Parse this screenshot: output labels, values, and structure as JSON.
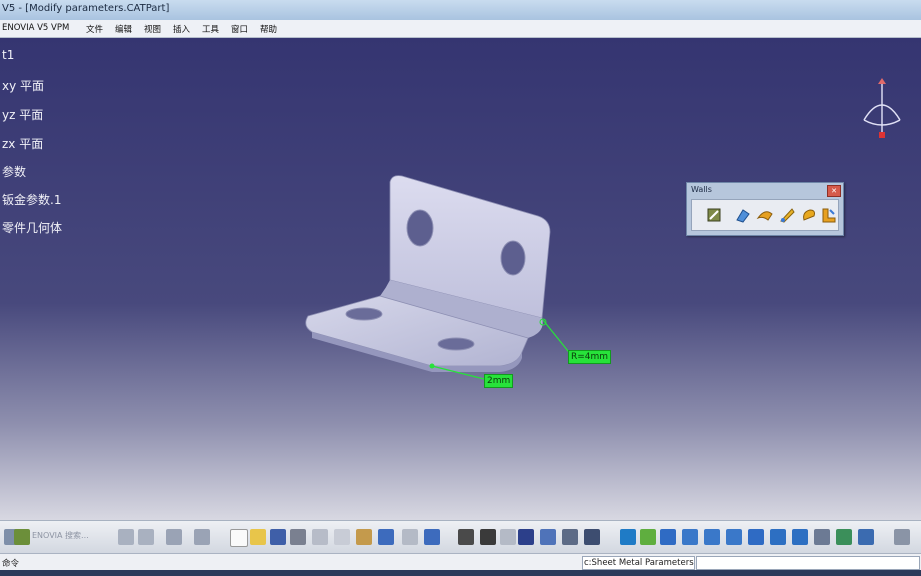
{
  "window": {
    "title": "V5 - [Modify parameters.CATPart]"
  },
  "menu": [
    {
      "id": "enovia",
      "label": "ENOVIA V5 VPM"
    },
    {
      "id": "file",
      "label": "文件"
    },
    {
      "id": "edit",
      "label": "编辑"
    },
    {
      "id": "view",
      "label": "视图"
    },
    {
      "id": "insert",
      "label": "插入"
    },
    {
      "id": "tools",
      "label": "工具"
    },
    {
      "id": "window",
      "label": "窗口"
    },
    {
      "id": "help",
      "label": "帮助"
    }
  ],
  "tree": [
    {
      "id": "root",
      "label": "t1"
    },
    {
      "id": "xy",
      "label": "xy 平面"
    },
    {
      "id": "yz",
      "label": "yz 平面"
    },
    {
      "id": "zx",
      "label": "zx 平面"
    },
    {
      "id": "params",
      "label": "参数"
    },
    {
      "id": "sheetmetal",
      "label": "钣金参数.1"
    },
    {
      "id": "body",
      "label": "零件几何体"
    }
  ],
  "walls_toolbar": {
    "title": "Walls",
    "tools": [
      "wall-icon",
      "wall-on-edge-icon",
      "extrusion-icon",
      "swept-flange-icon",
      "hem-icon",
      "tear-drop-icon"
    ]
  },
  "dimensions": {
    "radius": "R=4mm",
    "thickness": "2mm"
  },
  "toolbar": {
    "enovia_text": "ENOVIA 搜索..."
  },
  "status": {
    "left": "命令",
    "command": "c:Sheet Metal Parameters"
  },
  "colors": {
    "viewport_top": "#353571",
    "dimension_green": "#27e23a",
    "part_fill": "#c9cbe3"
  }
}
